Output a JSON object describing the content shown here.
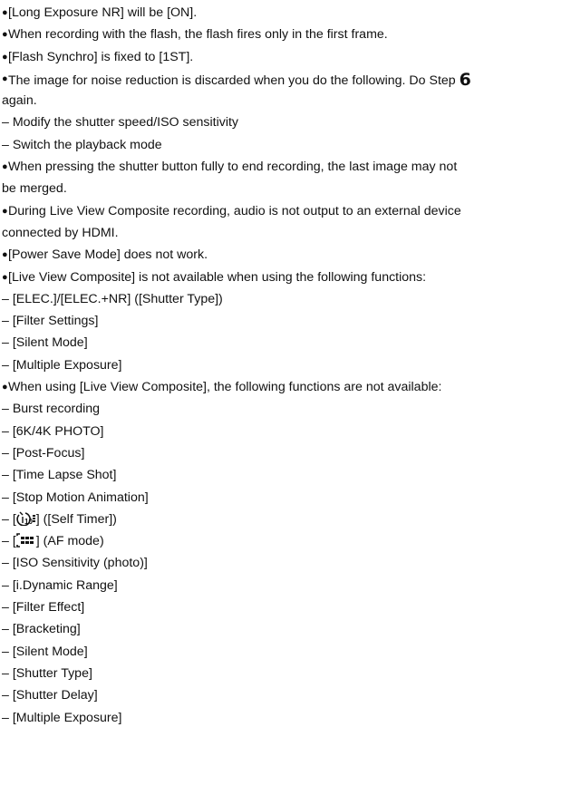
{
  "items": [
    {
      "type": "bullet",
      "text": "[Long Exposure NR] will be [ON]."
    },
    {
      "type": "bullet",
      "text": "When recording with the flash, the flash fires only in the first frame."
    },
    {
      "type": "bullet",
      "text": "[Flash Synchro] is fixed to [1ST]."
    },
    {
      "type": "bullet",
      "text": "The image for noise reduction is discarded when you do the following. Do Step ",
      "step": "6"
    },
    {
      "type": "cont",
      "text": "again."
    },
    {
      "type": "dash",
      "text": "– Modify the shutter speed/ISO sensitivity"
    },
    {
      "type": "dash",
      "text": "– Switch the playback mode"
    },
    {
      "type": "bullet",
      "text": "When pressing the shutter button fully to end recording, the last image may not"
    },
    {
      "type": "cont",
      "text": "be merged."
    },
    {
      "type": "bullet",
      "text": "During Live View Composite recording, audio is not output to an external device"
    },
    {
      "type": "cont",
      "text": "connected by HDMI."
    },
    {
      "type": "bullet",
      "text": "[Power Save Mode] does not work."
    },
    {
      "type": "bullet",
      "text": "[Live View Composite] is not available when using the following functions:"
    },
    {
      "type": "dash",
      "text": "– [ELEC.]/[ELEC.+NR] ([Shutter Type])"
    },
    {
      "type": "dash",
      "text": "– [Filter Settings]"
    },
    {
      "type": "dash",
      "text": "– [Silent Mode]"
    },
    {
      "type": "dash",
      "text": "– [Multiple Exposure]"
    },
    {
      "type": "bullet",
      "text": "When using [Live View Composite], the following functions are not available:"
    },
    {
      "type": "dash",
      "text": "– Burst recording"
    },
    {
      "type": "dash",
      "text": "– [6K/4K PHOTO]"
    },
    {
      "type": "dash",
      "text": "– [Post-Focus]"
    },
    {
      "type": "dash",
      "text": "– [Time Lapse Shot]"
    },
    {
      "type": "dash",
      "text": "– [Stop Motion Animation]"
    },
    {
      "type": "dash-icon",
      "prefix": "– [",
      "icon": "self-timer-icon",
      "suffix": "] ([Self Timer])"
    },
    {
      "type": "dash-icon",
      "prefix": "– [",
      "icon": "af-mode-icon",
      "suffix": "] (AF mode)"
    },
    {
      "type": "dash",
      "text": "– [ISO Sensitivity (photo)]"
    },
    {
      "type": "dash",
      "text": "– [i.Dynamic Range]"
    },
    {
      "type": "dash",
      "text": "– [Filter Effect]"
    },
    {
      "type": "dash",
      "text": "– [Bracketing]"
    },
    {
      "type": "dash",
      "text": "– [Silent Mode]"
    },
    {
      "type": "dash",
      "text": "– [Shutter Type]"
    },
    {
      "type": "dash",
      "text": "– [Shutter Delay]"
    },
    {
      "type": "dash",
      "text": "– [Multiple Exposure]"
    }
  ]
}
